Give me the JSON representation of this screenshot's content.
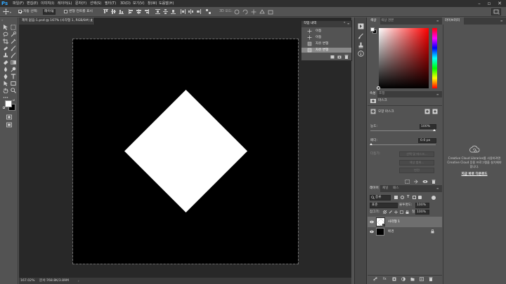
{
  "app": {
    "logo": "Ps"
  },
  "menu": [
    "파일(F)",
    "편집(E)",
    "이미지(I)",
    "레이어(L)",
    "문자(Y)",
    "선택(S)",
    "필터(T)",
    "3D(D)",
    "보기(V)",
    "창(W)",
    "도움말(H)"
  ],
  "options": {
    "auto_select_label": "자동 선택:",
    "auto_select_value": "레이어",
    "transform_label": "변형 컨트롤 표시"
  },
  "document": {
    "tab_title": "제목 없음-1.psd @ 167% (사각형 1, RGB/8#) *",
    "zoom": "167.02%",
    "doc_info": "문서:768.8K/3.89M"
  },
  "history": {
    "title": "작업 내역",
    "items": [
      {
        "label": "이동",
        "selected": false
      },
      {
        "label": "이동",
        "selected": false
      },
      {
        "label": "자유 변형",
        "selected": false
      },
      {
        "label": "자유 변형",
        "selected": true
      }
    ]
  },
  "color_panel": {
    "tabs": [
      "색상",
      "색상 견본"
    ],
    "accent": "#ff0000"
  },
  "properties": {
    "tabs": [
      "속성",
      "조정"
    ],
    "mask_label": "마스크",
    "vector_mask_label": "모양 마스크",
    "density_label": "농도:",
    "density_value": "100%",
    "feather_label": "페더:",
    "feather_value": "0.0 px",
    "refine_label": "다듬기:",
    "btn_select_mask": "선택 및 마스크...",
    "btn_color_range": "색상 범위...",
    "btn_invert": "반전"
  },
  "layers": {
    "tabs": [
      "레이어",
      "채널",
      "패스"
    ],
    "filter_kind": "종류",
    "blend_mode": "표준",
    "opacity_label": "불투명도:",
    "opacity_value": "100%",
    "lock_label": "잠그기:",
    "fill_label": "칠:",
    "fill_value": "100%",
    "items": [
      {
        "name": "사각형 1",
        "selected": true
      },
      {
        "name": "배경",
        "selected": false
      }
    ]
  },
  "libraries": {
    "tab": "라이브러리",
    "message": [
      "Creative Cloud Libraries를 사용하려면",
      "Creative Cloud 응용 프로그램을 설치해야",
      "합니다."
    ],
    "link": "지금 바로 다운로드"
  }
}
